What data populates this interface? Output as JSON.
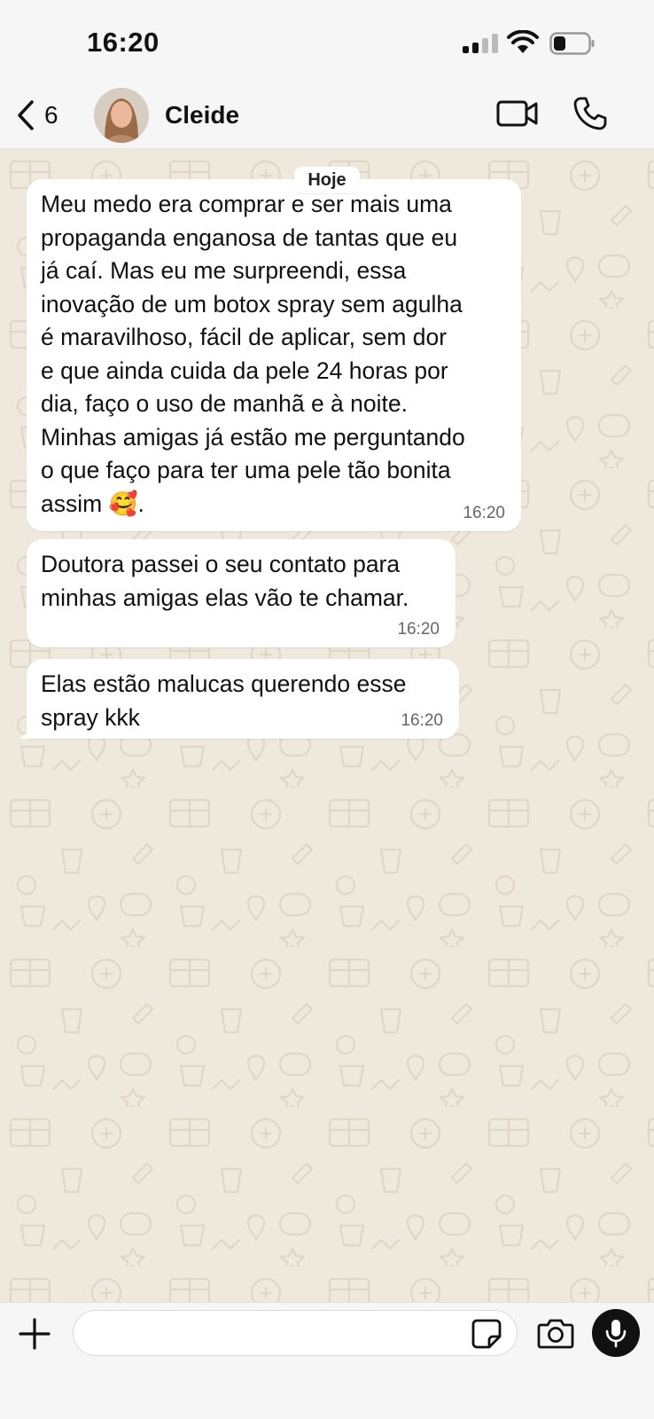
{
  "status_bar": {
    "time": "16:20",
    "icons": [
      "cellular-signal-icon",
      "wifi-icon",
      "battery-icon"
    ]
  },
  "header": {
    "back_count": "6",
    "contact_name": "Cleide",
    "icons": [
      "chevron-left-icon",
      "video-camera-icon",
      "phone-icon"
    ]
  },
  "chat": {
    "date_label": "Hoje",
    "messages": [
      {
        "text_lines": [
          "Meu medo era comprar e ser mais uma",
          "propaganda enganosa de tantas que eu",
          "já caí. Mas eu me surpreendi, essa",
          "inovação de um botox spray sem agulha",
          "é maravilhoso, fácil de aplicar, sem dor",
          "e que ainda cuida da pele 24 horas por",
          "dia, faço o uso de manhã e à noite.",
          "Minhas amigas já estão me perguntando",
          "o que faço para ter uma pele tão bonita",
          "assim 🥰."
        ],
        "time": "16:20"
      },
      {
        "text_lines": [
          "Doutora passei o seu contato para",
          "minhas amigas elas vão te chamar."
        ],
        "time": "16:20"
      },
      {
        "text_lines": [
          "Elas estão malucas querendo esse",
          "spray kkk"
        ],
        "time": "16:20"
      }
    ]
  },
  "input_bar": {
    "placeholder": "",
    "icons": [
      "plus-icon",
      "sticker-icon",
      "camera-icon",
      "microphone-icon"
    ]
  },
  "colors": {
    "chat_background": "#efe8dd",
    "bubble": "#ffffff",
    "pattern": "#e2d9cb"
  }
}
